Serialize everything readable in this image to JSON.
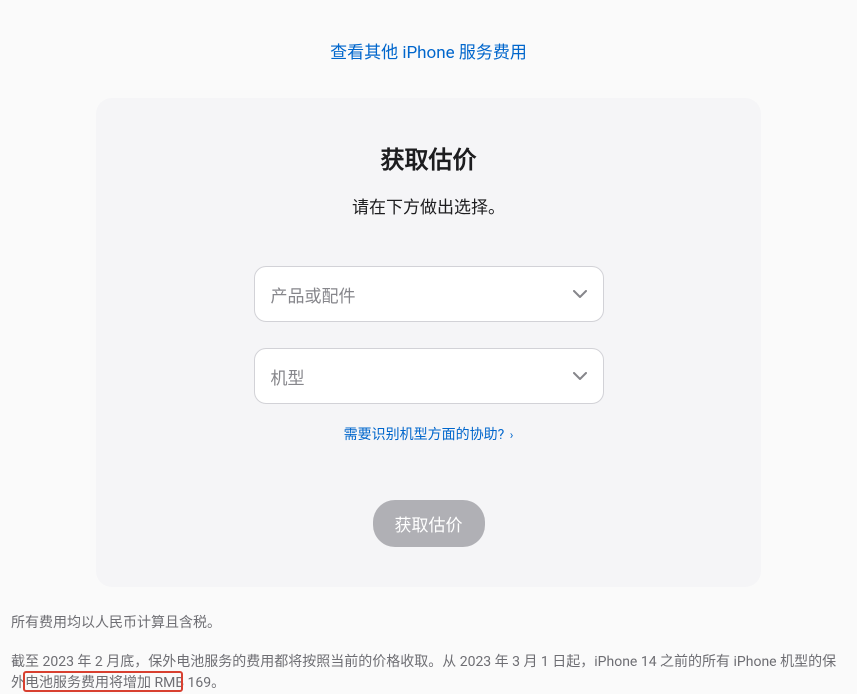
{
  "topLink": "查看其他 iPhone 服务费用",
  "card": {
    "title": "获取估价",
    "subtitle": "请在下方做出选择。",
    "select1": {
      "placeholder": "产品或配件"
    },
    "select2": {
      "placeholder": "机型"
    },
    "helpLink": "需要识别机型方面的协助?",
    "button": "获取估价"
  },
  "footer": {
    "line1": "所有费用均以人民币计算且含税。",
    "line2": "截至 2023 年 2 月底，保外电池服务的费用都将按照当前的价格收取。从 2023 年 3 月 1 日起，iPhone 14 之前的所有 iPhone 机型的保外电池服务费用将增加 RMB 169。"
  }
}
